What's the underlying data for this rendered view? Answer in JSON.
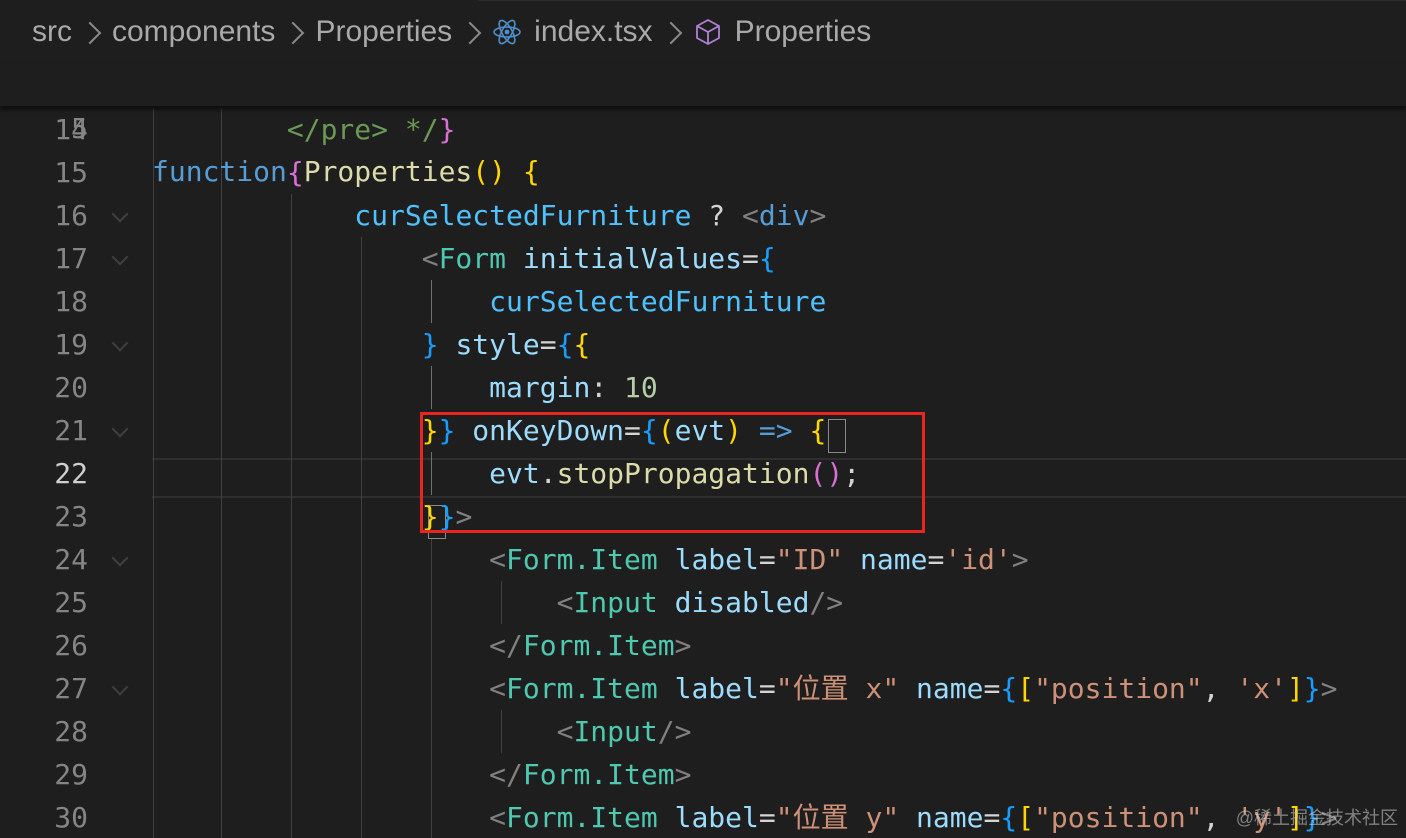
{
  "breadcrumbs": {
    "items": [
      {
        "label": "src",
        "icon": ""
      },
      {
        "label": "components",
        "icon": ""
      },
      {
        "label": "Properties",
        "icon": ""
      },
      {
        "label": "index.tsx",
        "icon": "react-icon"
      },
      {
        "label": "Properties",
        "icon": "cube-icon"
      }
    ]
  },
  "sticky_line": {
    "number": "5",
    "tokens": [
      {
        "t": "function",
        "c": "kw"
      },
      {
        "t": " ",
        "c": "pl"
      },
      {
        "t": "Properties",
        "c": "fn"
      },
      {
        "t": "()",
        "c": "b1"
      },
      {
        "t": " ",
        "c": "pl"
      },
      {
        "t": "{",
        "c": "b1"
      }
    ]
  },
  "lines": [
    {
      "number": "14",
      "fold": false,
      "tokens": [
        {
          "t": "        ",
          "c": "pl"
        },
        {
          "t": "</pre>",
          "c": "cmt"
        },
        {
          "t": " */",
          "c": "cmt"
        },
        {
          "t": "}",
          "c": "b2"
        }
      ]
    },
    {
      "number": "15",
      "fold": false,
      "tokens": [
        {
          "t": "        ",
          "c": "pl"
        },
        {
          "t": "{",
          "c": "b2"
        }
      ]
    },
    {
      "number": "16",
      "fold": true,
      "tokens": [
        {
          "t": "            ",
          "c": "pl"
        },
        {
          "t": "curSelectedFurniture",
          "c": "var"
        },
        {
          "t": " ? ",
          "c": "op"
        },
        {
          "t": "<",
          "c": "tag"
        },
        {
          "t": "div",
          "c": "kw"
        },
        {
          "t": ">",
          "c": "tag"
        }
      ]
    },
    {
      "number": "17",
      "fold": true,
      "tokens": [
        {
          "t": "                ",
          "c": "pl"
        },
        {
          "t": "<",
          "c": "tag"
        },
        {
          "t": "Form",
          "c": "comp"
        },
        {
          "t": " ",
          "c": "pl"
        },
        {
          "t": "initialValues",
          "c": "prop"
        },
        {
          "t": "=",
          "c": "op"
        },
        {
          "t": "{",
          "c": "b3"
        }
      ]
    },
    {
      "number": "18",
      "fold": false,
      "tokens": [
        {
          "t": "                    ",
          "c": "pl"
        },
        {
          "t": "curSelectedFurniture",
          "c": "var"
        }
      ]
    },
    {
      "number": "19",
      "fold": true,
      "tokens": [
        {
          "t": "                ",
          "c": "pl"
        },
        {
          "t": "}",
          "c": "b3"
        },
        {
          "t": " ",
          "c": "pl"
        },
        {
          "t": "style",
          "c": "prop"
        },
        {
          "t": "=",
          "c": "op"
        },
        {
          "t": "{",
          "c": "b3"
        },
        {
          "t": "{",
          "c": "b1"
        }
      ]
    },
    {
      "number": "20",
      "fold": false,
      "tokens": [
        {
          "t": "                    ",
          "c": "pl"
        },
        {
          "t": "margin",
          "c": "prop"
        },
        {
          "t": ": ",
          "c": "pl"
        },
        {
          "t": "10",
          "c": "num"
        }
      ]
    },
    {
      "number": "21",
      "fold": true,
      "tokens": [
        {
          "t": "                ",
          "c": "pl"
        },
        {
          "t": "}",
          "c": "b1"
        },
        {
          "t": "}",
          "c": "b3"
        },
        {
          "t": " ",
          "c": "pl"
        },
        {
          "t": "onKeyDown",
          "c": "prop"
        },
        {
          "t": "=",
          "c": "op"
        },
        {
          "t": "{",
          "c": "b3"
        },
        {
          "t": "(",
          "c": "b1"
        },
        {
          "t": "evt",
          "c": "prop"
        },
        {
          "t": ")",
          "c": "b1"
        },
        {
          "t": " ",
          "c": "pl"
        },
        {
          "t": "=>",
          "c": "kw"
        },
        {
          "t": " ",
          "c": "pl"
        },
        {
          "t": "{",
          "c": "b1"
        }
      ]
    },
    {
      "number": "22",
      "fold": false,
      "active": true,
      "tokens": [
        {
          "t": "                    ",
          "c": "pl"
        },
        {
          "t": "evt",
          "c": "prop"
        },
        {
          "t": ".",
          "c": "pl"
        },
        {
          "t": "stopPropagation",
          "c": "fn"
        },
        {
          "t": "()",
          "c": "b2"
        },
        {
          "t": ";",
          "c": "pl"
        }
      ]
    },
    {
      "number": "23",
      "fold": false,
      "tokens": [
        {
          "t": "                ",
          "c": "pl"
        },
        {
          "t": "}",
          "c": "b1"
        },
        {
          "t": "}",
          "c": "b3"
        },
        {
          "t": ">",
          "c": "tag"
        }
      ]
    },
    {
      "number": "24",
      "fold": true,
      "tokens": [
        {
          "t": "                    ",
          "c": "pl"
        },
        {
          "t": "<",
          "c": "tag"
        },
        {
          "t": "Form.Item",
          "c": "comp"
        },
        {
          "t": " ",
          "c": "pl"
        },
        {
          "t": "label",
          "c": "prop"
        },
        {
          "t": "=",
          "c": "op"
        },
        {
          "t": "\"ID\"",
          "c": "str"
        },
        {
          "t": " ",
          "c": "pl"
        },
        {
          "t": "name",
          "c": "prop"
        },
        {
          "t": "=",
          "c": "op"
        },
        {
          "t": "'id'",
          "c": "str"
        },
        {
          "t": ">",
          "c": "tag"
        }
      ]
    },
    {
      "number": "25",
      "fold": false,
      "tokens": [
        {
          "t": "                        ",
          "c": "pl"
        },
        {
          "t": "<",
          "c": "tag"
        },
        {
          "t": "Input",
          "c": "comp"
        },
        {
          "t": " ",
          "c": "pl"
        },
        {
          "t": "disabled",
          "c": "prop"
        },
        {
          "t": "/>",
          "c": "tag"
        }
      ]
    },
    {
      "number": "26",
      "fold": false,
      "tokens": [
        {
          "t": "                    ",
          "c": "pl"
        },
        {
          "t": "</",
          "c": "tag"
        },
        {
          "t": "Form.Item",
          "c": "comp"
        },
        {
          "t": ">",
          "c": "tag"
        }
      ]
    },
    {
      "number": "27",
      "fold": true,
      "tokens": [
        {
          "t": "                    ",
          "c": "pl"
        },
        {
          "t": "<",
          "c": "tag"
        },
        {
          "t": "Form.Item",
          "c": "comp"
        },
        {
          "t": " ",
          "c": "pl"
        },
        {
          "t": "label",
          "c": "prop"
        },
        {
          "t": "=",
          "c": "op"
        },
        {
          "t": "\"位置 x\"",
          "c": "str"
        },
        {
          "t": " ",
          "c": "pl"
        },
        {
          "t": "name",
          "c": "prop"
        },
        {
          "t": "=",
          "c": "op"
        },
        {
          "t": "{",
          "c": "b3"
        },
        {
          "t": "[",
          "c": "b1"
        },
        {
          "t": "\"position\"",
          "c": "str"
        },
        {
          "t": ", ",
          "c": "pl"
        },
        {
          "t": "'x'",
          "c": "str"
        },
        {
          "t": "]",
          "c": "b1"
        },
        {
          "t": "}",
          "c": "b3"
        },
        {
          "t": ">",
          "c": "tag"
        }
      ]
    },
    {
      "number": "28",
      "fold": false,
      "tokens": [
        {
          "t": "                        ",
          "c": "pl"
        },
        {
          "t": "<",
          "c": "tag"
        },
        {
          "t": "Input",
          "c": "comp"
        },
        {
          "t": "/>",
          "c": "tag"
        }
      ]
    },
    {
      "number": "29",
      "fold": false,
      "tokens": [
        {
          "t": "                    ",
          "c": "pl"
        },
        {
          "t": "</",
          "c": "tag"
        },
        {
          "t": "Form.Item",
          "c": "comp"
        },
        {
          "t": ">",
          "c": "tag"
        }
      ]
    },
    {
      "number": "30",
      "fold": false,
      "tokens": [
        {
          "t": "                    ",
          "c": "pl"
        },
        {
          "t": "<",
          "c": "tag"
        },
        {
          "t": "Form.Item",
          "c": "comp"
        },
        {
          "t": " ",
          "c": "pl"
        },
        {
          "t": "label",
          "c": "prop"
        },
        {
          "t": "=",
          "c": "op"
        },
        {
          "t": "\"位置 y\"",
          "c": "str"
        },
        {
          "t": " ",
          "c": "pl"
        },
        {
          "t": "name",
          "c": "prop"
        },
        {
          "t": "=",
          "c": "op"
        },
        {
          "t": "{",
          "c": "b3"
        },
        {
          "t": "[",
          "c": "b1"
        },
        {
          "t": "\"position\"",
          "c": "str"
        },
        {
          "t": ", ",
          "c": "pl"
        },
        {
          "t": "'y'",
          "c": "str"
        },
        {
          "t": "]",
          "c": "b1"
        },
        {
          "t": "}",
          "c": "b3"
        },
        {
          "t": ">",
          "c": "tag"
        }
      ]
    }
  ],
  "watermark": "@稀土掘金技术社区"
}
